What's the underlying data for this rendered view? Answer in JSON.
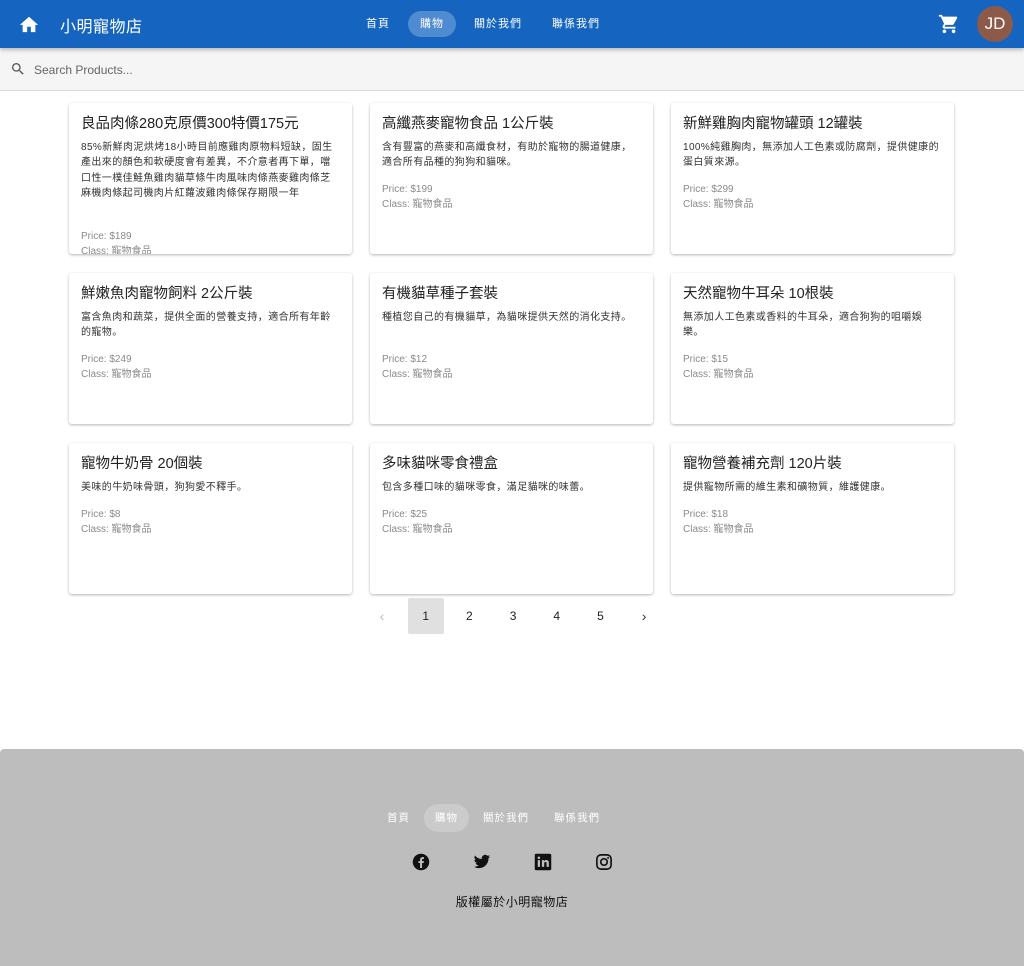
{
  "header": {
    "brand": "小明寵物店",
    "nav": [
      "首頁",
      "購物",
      "關於我們",
      "聯係我們"
    ],
    "active_nav": 1,
    "avatar_initials": "JD"
  },
  "search": {
    "placeholder": "Search Products..."
  },
  "products": [
    {
      "title": "良品肉條280克原價300特價175元",
      "desc": "85%新鮮肉泥烘烤18小時目前應雞肉原物料短缺，固生產出來的顏色和軟硬度會有差異，不介意者再下單，噹口性一樸佳鮭魚雞肉貓草條牛肉風味肉條燕麥雞肉條芝麻機肉條起司機肉片紅蘿波雞肉條保存期限一年",
      "price": "Price: $189",
      "class": "Class: 寵物食品"
    },
    {
      "title": "高纖燕麥寵物食品 1公斤裝",
      "desc": "含有豐富的燕麥和高纖食材，有助於寵物的腸道健康，適合所有品種的狗狗和貓咪。",
      "price": "Price: $199",
      "class": "Class: 寵物食品"
    },
    {
      "title": "新鮮雞胸肉寵物罐頭 12罐裝",
      "desc": "100%純雞胸肉，無添加人工色素或防腐劑，提供健康的蛋白質來源。",
      "price": "Price: $299",
      "class": "Class: 寵物食品"
    },
    {
      "title": "鮮嫩魚肉寵物飼料 2公斤裝",
      "desc": "富含魚肉和蔬菜，提供全面的營養支持，適合所有年齡的寵物。",
      "price": "Price: $249",
      "class": "Class: 寵物食品"
    },
    {
      "title": "有機貓草種子套裝",
      "desc": "種植您自己的有機貓草，為貓咪提供天然的消化支持。",
      "price": "Price: $12",
      "class": "Class: 寵物食品"
    },
    {
      "title": "天然寵物牛耳朵 10根裝",
      "desc": "無添加人工色素或香料的牛耳朵，適合狗狗的咀嚼娛樂。",
      "price": "Price: $15",
      "class": "Class: 寵物食品"
    },
    {
      "title": "寵物牛奶骨 20個裝",
      "desc": "美味的牛奶味骨頭，狗狗愛不釋手。",
      "price": "Price: $8",
      "class": "Class: 寵物食品"
    },
    {
      "title": "多味貓咪零食禮盒",
      "desc": "包含多種口味的貓咪零食，滿足貓咪的味蕾。",
      "price": "Price: $25",
      "class": "Class: 寵物食品"
    },
    {
      "title": "寵物營養補充劑 120片裝",
      "desc": "提供寵物所需的維生素和礦物質，維護健康。",
      "price": "Price: $18",
      "class": "Class: 寵物食品"
    }
  ],
  "pagination": {
    "prev": "‹",
    "next": "›",
    "pages": [
      "1",
      "2",
      "3",
      "4",
      "5"
    ],
    "current": "1"
  },
  "footer": {
    "nav": [
      "首頁",
      "購物",
      "關於我們",
      "聯係我們"
    ],
    "active_nav": 1,
    "social_icons": [
      "facebook-icon",
      "twitter-icon",
      "linkedin-icon",
      "instagram-icon"
    ],
    "copyright": "版權屬於小明寵物店"
  },
  "colors": {
    "primary": "#1565c0",
    "footer_bg": "#bdbdbd",
    "avatar": "#8d5a4a"
  }
}
